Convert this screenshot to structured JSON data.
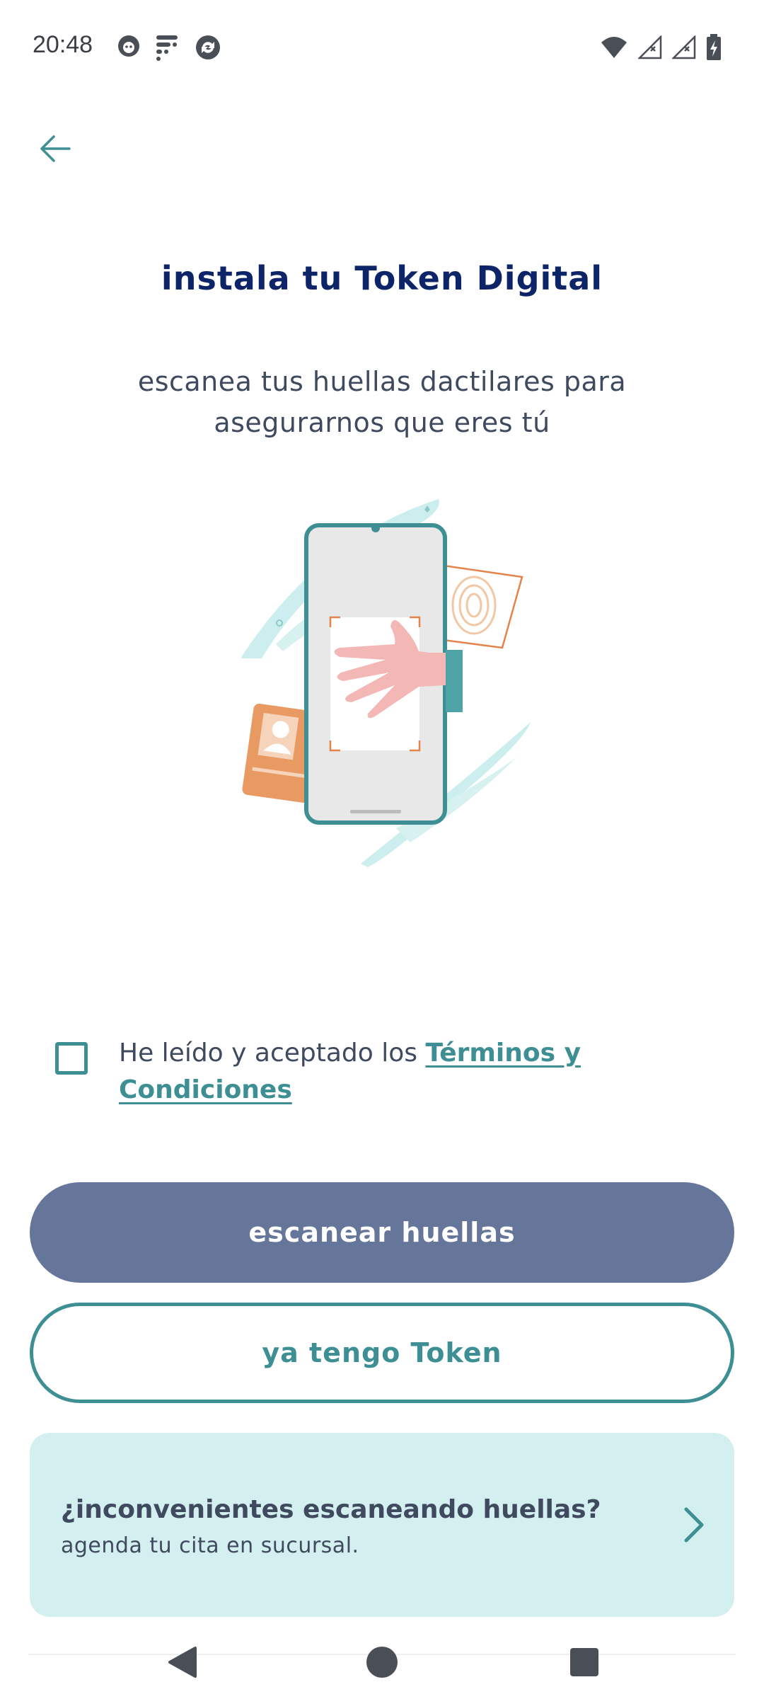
{
  "status_bar": {
    "time": "20:48",
    "left_icons": [
      "cat-notification-icon",
      "app-notification-icon",
      "sync-notification-icon"
    ],
    "right_icons": [
      "wifi-icon",
      "signal-icon",
      "signal-icon-2",
      "battery-charging-icon"
    ]
  },
  "header": {
    "back_icon": "arrow-left-icon"
  },
  "main": {
    "title": "instala tu Token Digital",
    "subtitle": "escanea tus huellas dactilares para asegurarnos que eres tú"
  },
  "terms": {
    "prefix": "He leído y aceptado los ",
    "link": "Términos y Condiciones",
    "checked": false
  },
  "buttons": {
    "primary_label": "escanear huellas",
    "secondary_label": "ya tengo Token"
  },
  "help_card": {
    "title": "¿inconvenientes escaneando huellas?",
    "subtitle": "agenda tu cita en sucursal."
  },
  "colors": {
    "title": "#0e2468",
    "accent": "#3d8f94",
    "primary_button": "#66769a",
    "help_card_bg": "#d4efef"
  }
}
